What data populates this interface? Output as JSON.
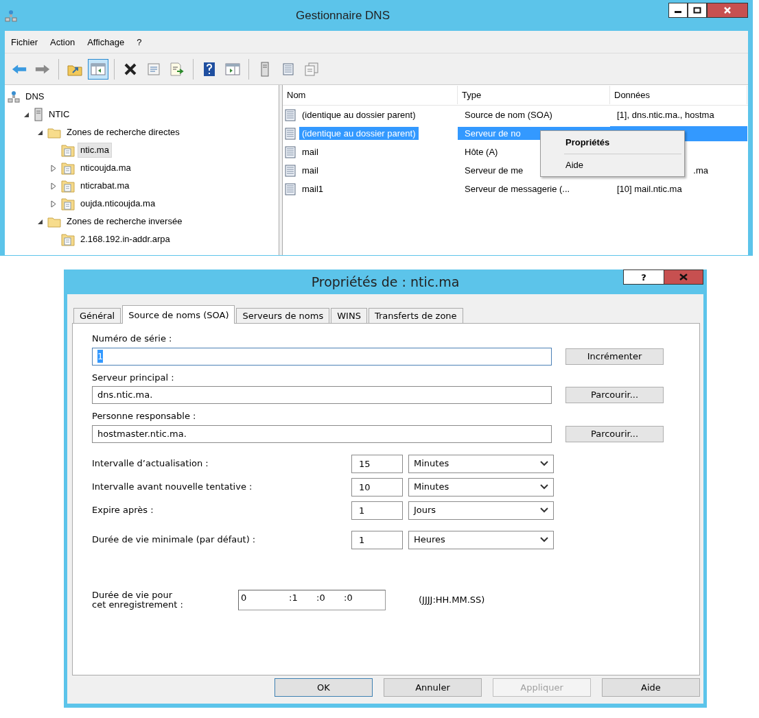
{
  "dns_window": {
    "title": "Gestionnaire DNS",
    "menu": [
      "Fichier",
      "Action",
      "Affichage",
      "?"
    ],
    "toolbar": [
      {
        "kind": "back",
        "pressed": false
      },
      {
        "kind": "forward",
        "pressed": false
      },
      {
        "kind": "separator"
      },
      {
        "kind": "up",
        "pressed": false
      },
      {
        "kind": "tree",
        "pressed": true
      },
      {
        "kind": "separator"
      },
      {
        "kind": "delete",
        "pressed": false
      },
      {
        "kind": "properties",
        "pressed": false
      },
      {
        "kind": "export",
        "pressed": false
      },
      {
        "kind": "separator"
      },
      {
        "kind": "help",
        "pressed": false
      },
      {
        "kind": "pane",
        "pressed": false
      },
      {
        "kind": "separator"
      },
      {
        "kind": "server",
        "pressed": false
      },
      {
        "kind": "record",
        "pressed": false
      },
      {
        "kind": "copy",
        "pressed": false
      }
    ],
    "tree": [
      {
        "label": "DNS",
        "kind": "dns",
        "selected": false,
        "children": [
          {
            "label": "NTIC",
            "kind": "server",
            "selected": false,
            "expanded": true,
            "children": [
              {
                "label": "Zones de recherche directes",
                "kind": "folder",
                "selected": false,
                "expanded": true,
                "children": [
                  {
                    "label": "ntic.ma",
                    "kind": "zone",
                    "selected": true
                  },
                  {
                    "label": "nticoujda.ma",
                    "kind": "zone",
                    "selected": false,
                    "expanded": false
                  },
                  {
                    "label": "nticrabat.ma",
                    "kind": "zone",
                    "selected": false,
                    "expanded": false
                  },
                  {
                    "label": "oujda.nticoujda.ma",
                    "kind": "zone",
                    "selected": false,
                    "expanded": false
                  }
                ]
              },
              {
                "label": "Zones de recherche inversée",
                "kind": "folder",
                "selected": false,
                "expanded": true,
                "children": [
                  {
                    "label": "2.168.192.in-addr.arpa",
                    "kind": "zone",
                    "selected": false
                  }
                ]
              }
            ]
          }
        ]
      }
    ],
    "list": {
      "columns": [
        "Nom",
        "Type",
        "Données"
      ],
      "rows": [
        {
          "cells": [
            "(identique au dossier parent)",
            "Source de nom (SOA)",
            "[1], dns.ntic.ma., hostma"
          ],
          "selected": false
        },
        {
          "cells": [
            "(identique au dossier parent)",
            "Serveur de no",
            ""
          ],
          "selected": true
        },
        {
          "cells": [
            "mail",
            "Hôte (A)",
            ""
          ],
          "selected": false
        },
        {
          "cells": [
            "mail",
            "Serveur de me",
            ".ma"
          ],
          "selected": false,
          "start_covered": true
        },
        {
          "cells": [
            "mail1",
            "Serveur de messagerie (...",
            "[10]  mail.ntic.ma"
          ],
          "selected": false
        }
      ]
    },
    "context_menu": [
      {
        "label": "Propriétés",
        "default": true
      },
      {
        "label": "Aide",
        "default": false
      }
    ]
  },
  "dialog": {
    "title": "Propriétés de : ntic.ma",
    "help_button": "?",
    "tabs": [
      {
        "label": "Général",
        "selected": false
      },
      {
        "label": "Source de noms (SOA)",
        "selected": true
      },
      {
        "label": "Serveurs de noms",
        "selected": false
      },
      {
        "label": "WINS",
        "selected": false
      },
      {
        "label": "Transferts de zone",
        "selected": false
      }
    ],
    "fields": [
      {
        "label": "Numéro de série :",
        "value": "1",
        "text_selected": true,
        "button": "Incrémenter"
      },
      {
        "label": "Serveur principal :",
        "value": "dns.ntic.ma.",
        "text_selected": false,
        "button": "Parcourir..."
      },
      {
        "label": "Personne responsable :",
        "value": "hostmaster.ntic.ma.",
        "text_selected": false,
        "button": "Parcourir..."
      }
    ],
    "intervals": [
      {
        "label": "Intervalle d’actualisation :",
        "value": "15",
        "unit": "Minutes"
      },
      {
        "label": "Intervalle avant nouvelle tentative :",
        "value": "10",
        "unit": "Minutes"
      },
      {
        "label": "Expire après :",
        "value": "1",
        "unit": "Jours"
      },
      {
        "label": "Durée de vie minimale (par défaut) :",
        "value": "1",
        "unit": "Heures"
      }
    ],
    "ttl": {
      "label": "Durée de vie pour\ncet enregistrement :",
      "parts": [
        "0",
        ":1",
        ":0",
        ":0"
      ],
      "format": "(JJJJ:HH.MM.SS)"
    },
    "buttons": [
      {
        "label": "OK",
        "default": true,
        "disabled": false
      },
      {
        "label": "Annuler",
        "default": false,
        "disabled": false
      },
      {
        "label": "Appliquer",
        "default": false,
        "disabled": true
      },
      {
        "label": "Aide",
        "default": false,
        "disabled": false
      }
    ]
  }
}
